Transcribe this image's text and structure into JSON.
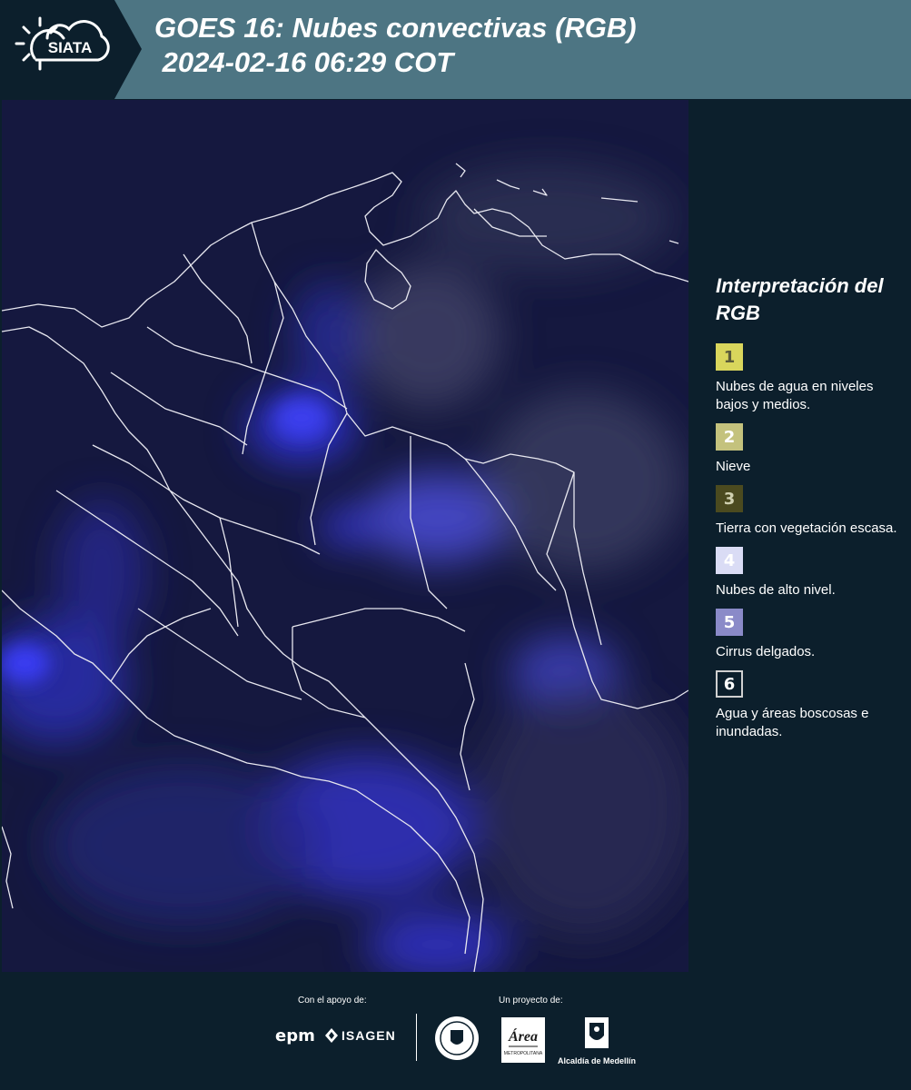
{
  "header": {
    "logo_text": "SIATA",
    "title": "GOES 16: Nubes convectivas (RGB)\n 2024-02-16 06:29 COT"
  },
  "legend": {
    "title": "Interpretación del RGB",
    "items": [
      {
        "number": "1",
        "label": "Nubes de agua en niveles bajos y medios.",
        "color": "#d9d65c",
        "text_color": "#5a5a3a"
      },
      {
        "number": "2",
        "label": "Nieve",
        "color": "#c4c27d",
        "text_color": "#ffffff"
      },
      {
        "number": "3",
        "label": "Tierra con vegetación escasa.",
        "color": "#4b4a1f",
        "text_color": "#d0d0b0"
      },
      {
        "number": "4",
        "label": "Nubes de alto nivel.",
        "color": "#dadcf5",
        "text_color": "#ffffff"
      },
      {
        "number": "5",
        "label": "Cirrus delgados.",
        "color": "#8a8ac8",
        "text_color": "#ffffff"
      },
      {
        "number": "6",
        "label": "Agua y áreas boscosas e inundadas.",
        "color": "#0c1f2c",
        "text_color": "#ffffff"
      }
    ]
  },
  "footer": {
    "support_label": "Con el apoyo de:",
    "project_label": "Un proyecto de:",
    "sponsors": [
      "epm",
      "ISAGEN"
    ],
    "partners": [
      "Área Metropolitana Valle de Aburrá",
      "Alcaldía de Medellín"
    ],
    "alcaldia_label": "Alcaldía de Medellín",
    "area_logo_text": "Área",
    "area_logo_sub": "METROPOLITANA"
  },
  "colors": {
    "header_bg": "#4d7583",
    "page_bg": "#0c1f2c",
    "map_bg": "#15183f",
    "convective_blue": "#3b3cf0"
  }
}
